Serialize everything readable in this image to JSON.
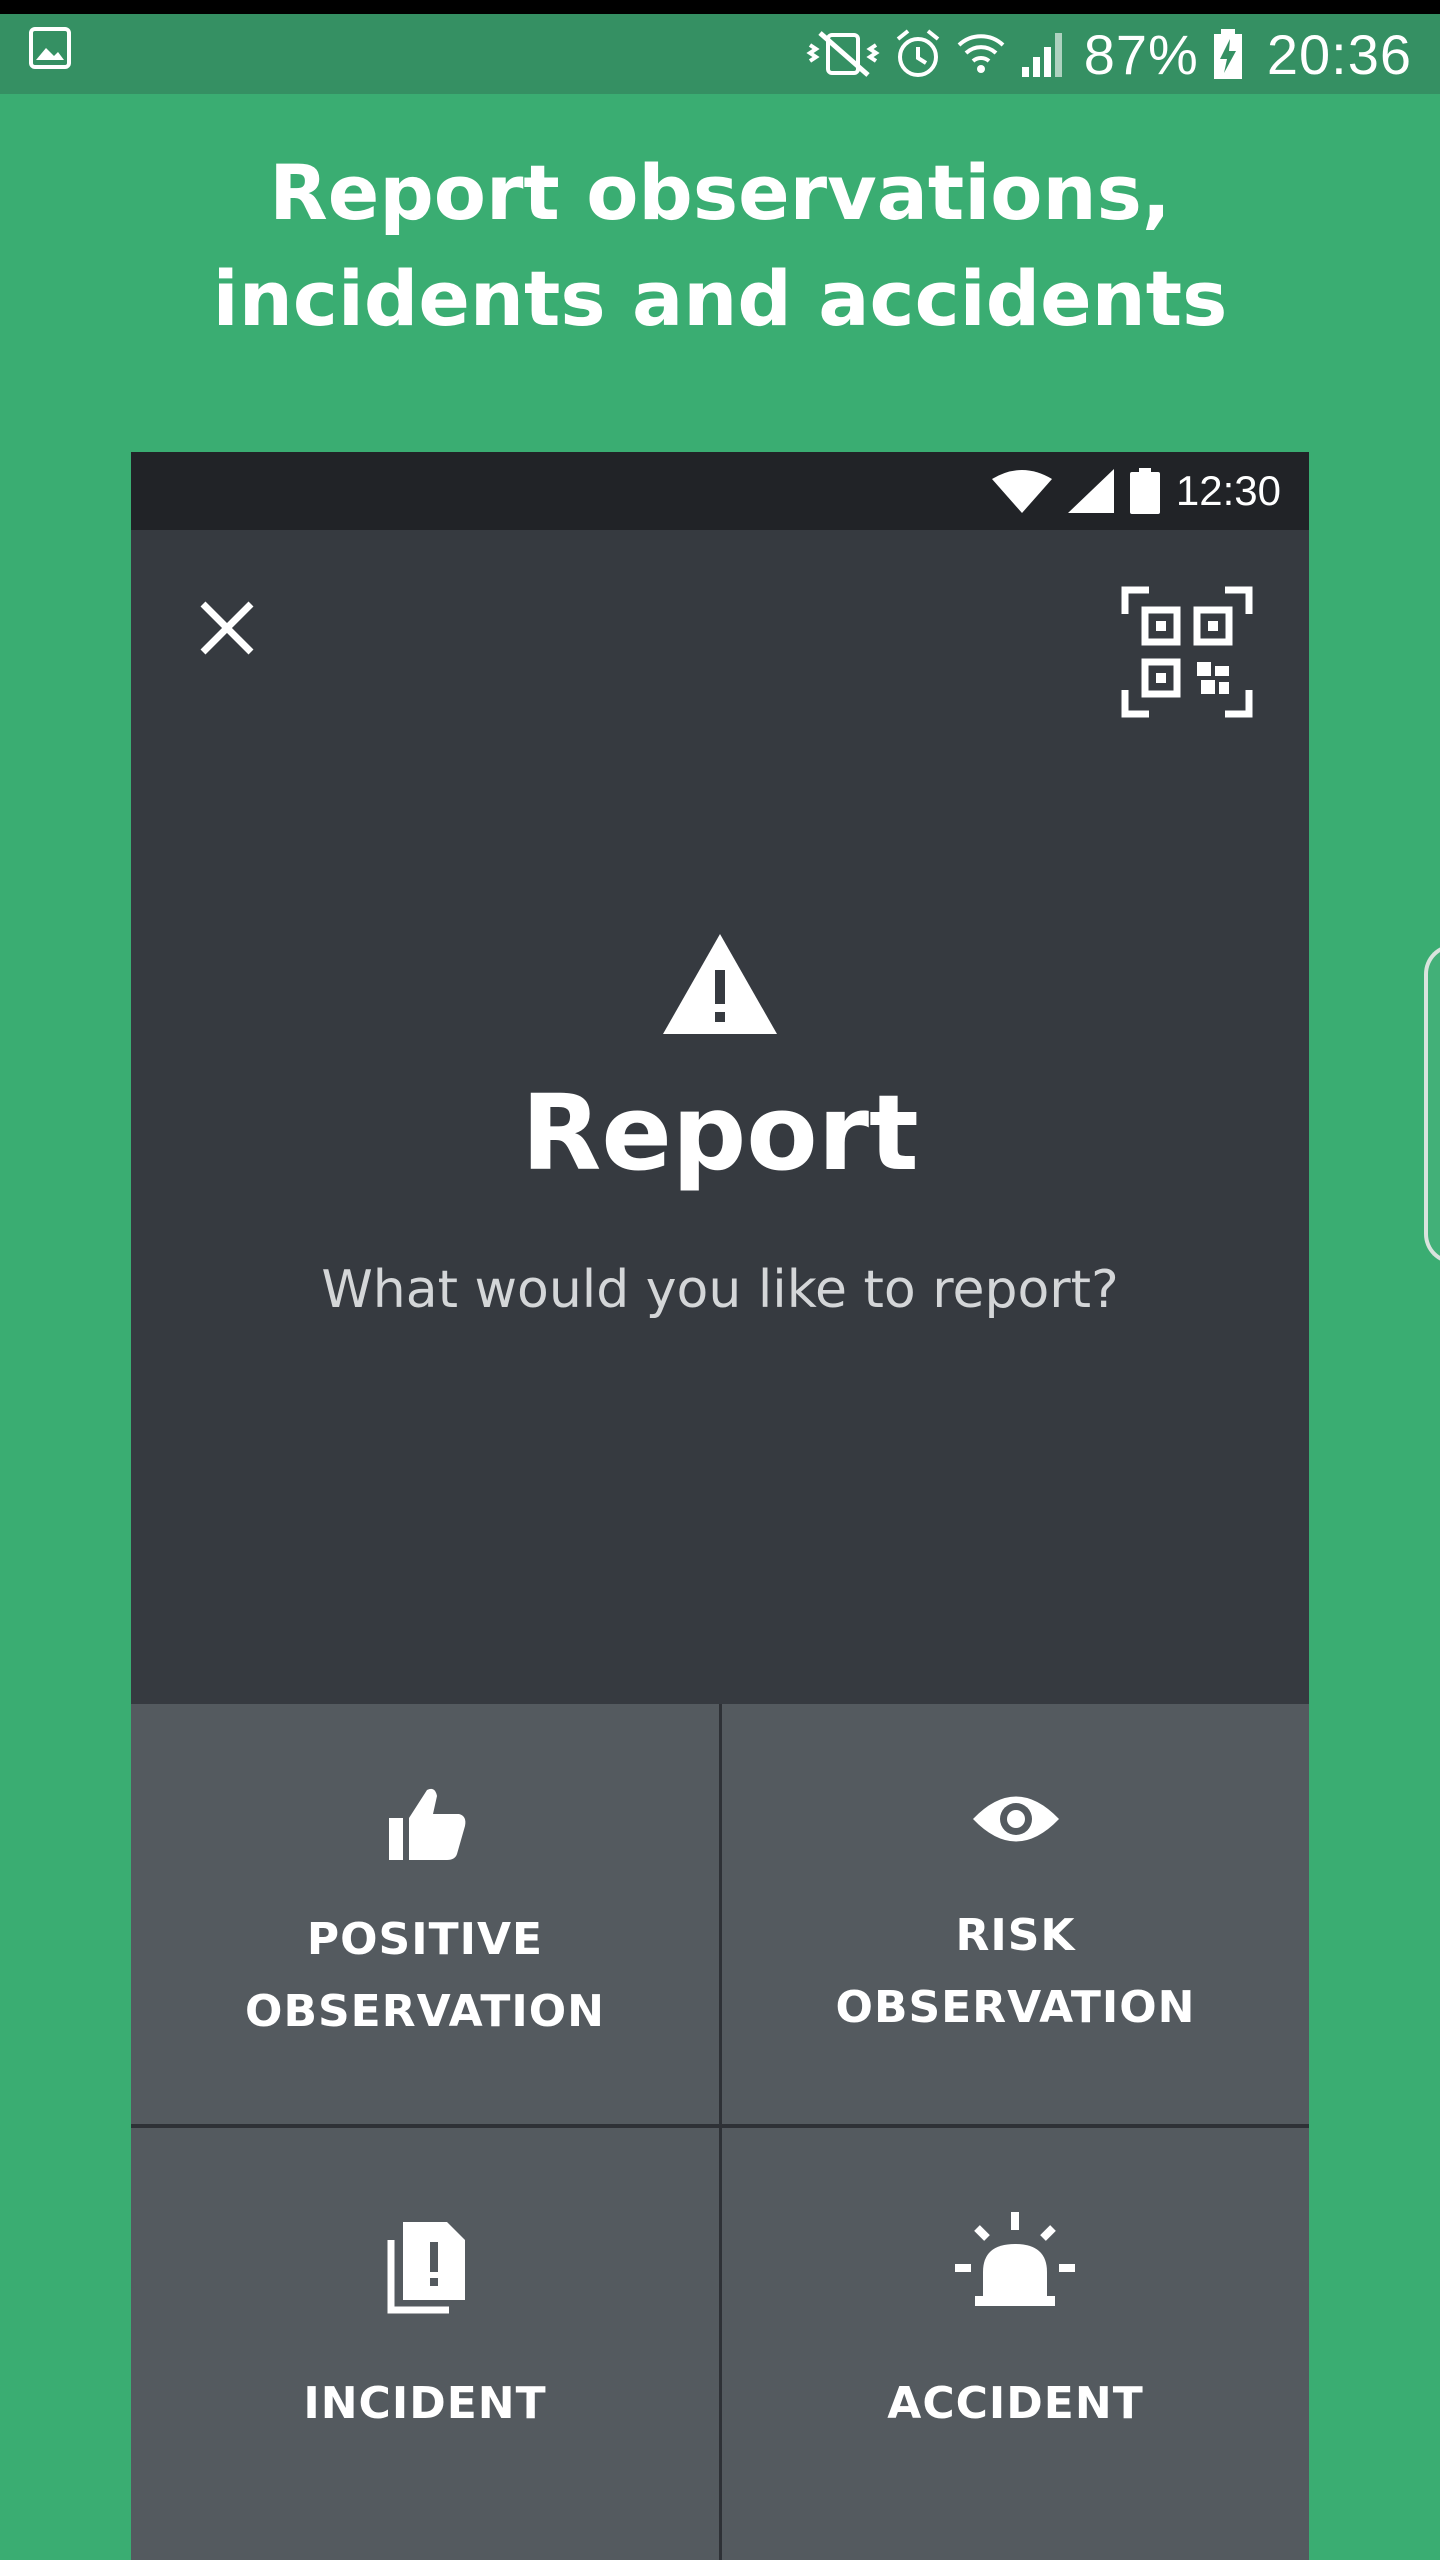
{
  "status_bar": {
    "battery_percent": "87%",
    "time": "20:36",
    "icons": [
      "gallery-icon",
      "vibrate-mute-icon",
      "alarm-icon",
      "wifi-icon",
      "signal-icon",
      "battery-charging-icon"
    ]
  },
  "headline": {
    "line1": "Report observations,",
    "line2": "incidents and accidents"
  },
  "phone_mockup": {
    "status_time": "12:30",
    "title": "Report",
    "subtitle": "What would you like to report?",
    "options": [
      {
        "line1": "POSITIVE",
        "line2": "OBSERVATION",
        "icon": "thumbs-up-icon"
      },
      {
        "line1": "RISK",
        "line2": "OBSERVATION",
        "icon": "eye-icon"
      },
      {
        "line1": "INCIDENT",
        "icon": "incident-document-icon"
      },
      {
        "line1": "ACCIDENT",
        "icon": "siren-icon"
      }
    ]
  },
  "colors": {
    "background": "#3aad72",
    "status_bar": "#359063",
    "phone_screen": "#363a40",
    "tile": "#545a5f"
  }
}
